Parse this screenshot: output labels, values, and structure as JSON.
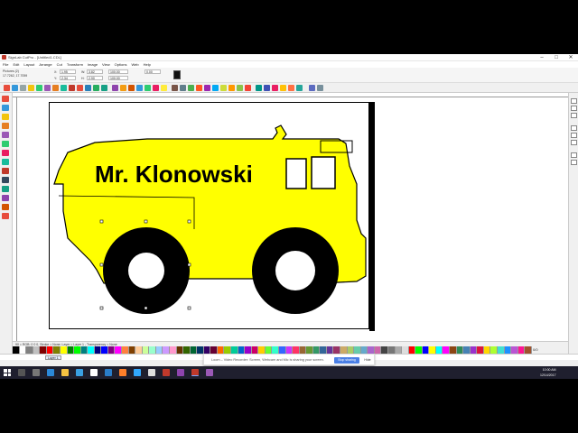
{
  "window": {
    "title": "SignLab CutPro - [Untitled1.CDL]",
    "controls": [
      "–",
      "□",
      "✕"
    ]
  },
  "menu": [
    "File",
    "Edit",
    "Layout",
    "Arrange",
    "Cut",
    "Transform",
    "Image",
    "View",
    "Options",
    "Web",
    "Help"
  ],
  "propbar": {
    "object_label": "Pictures (2)",
    "object_sub": "17.7262, 17.7059",
    "x_label": "X:",
    "x_value": "1.95",
    "y_label": "Y:",
    "y_value": "2.34",
    "w_label": "W:",
    "w_value": "3.82",
    "h_label": "H:",
    "h_value": "2.90",
    "pw_value": "100.00",
    "ph_value": "100.00",
    "angle_value": "0.00"
  },
  "canvas": {
    "truck_text": "Mr. Klonowski",
    "truck_color": "#ffff00",
    "outline_color": "#000000"
  },
  "status": {
    "text": "90 = RGB: 0 0 0, Stroke = None; Layer = Layer 1 - Transparency = None"
  },
  "page_indicator": "0/0",
  "layer_tab": "Layer 1",
  "loom": {
    "message": "Loom – Video Recorder: Screen, Webcam and Mic is sharing your screen.",
    "stop_label": "Stop sharing",
    "hide_label": "Hide"
  },
  "clock": {
    "time": "10:00 AM",
    "date": "12/14/2017"
  },
  "palette": [
    "#000000",
    "#ffffff",
    "#808080",
    "#c0c0c0",
    "#800000",
    "#ff0000",
    "#808000",
    "#ffff00",
    "#008000",
    "#00ff00",
    "#008080",
    "#00ffff",
    "#000080",
    "#0000ff",
    "#800080",
    "#ff00ff",
    "#ff8040",
    "#804000",
    "#ffcc99",
    "#ccff99",
    "#99ffcc",
    "#99ccff",
    "#cc99ff",
    "#ff99cc",
    "#663300",
    "#336600",
    "#006633",
    "#003366",
    "#330066",
    "#660033",
    "#ff6600",
    "#99cc00",
    "#00cc99",
    "#0066cc",
    "#9900cc",
    "#cc0066",
    "#ffcc00",
    "#66ff33",
    "#33ffcc",
    "#3366ff",
    "#cc33ff",
    "#ff3366",
    "#996633",
    "#669933",
    "#339966",
    "#336699",
    "#663399",
    "#993366",
    "#ccaa66",
    "#aacc66",
    "#66ccaa",
    "#66aacc",
    "#aa66cc",
    "#cc66aa",
    "#444444",
    "#777777",
    "#aaaaaa",
    "#dddddd",
    "#ff0000",
    "#00ff00",
    "#0000ff",
    "#ffff00",
    "#00ffff",
    "#ff00ff",
    "#8b4513",
    "#2e8b57",
    "#4682b4",
    "#9932cc",
    "#dc143c",
    "#ffd700",
    "#adff2f",
    "#40e0d0",
    "#1e90ff",
    "#ba55d3",
    "#ff1493",
    "#a0522d"
  ]
}
